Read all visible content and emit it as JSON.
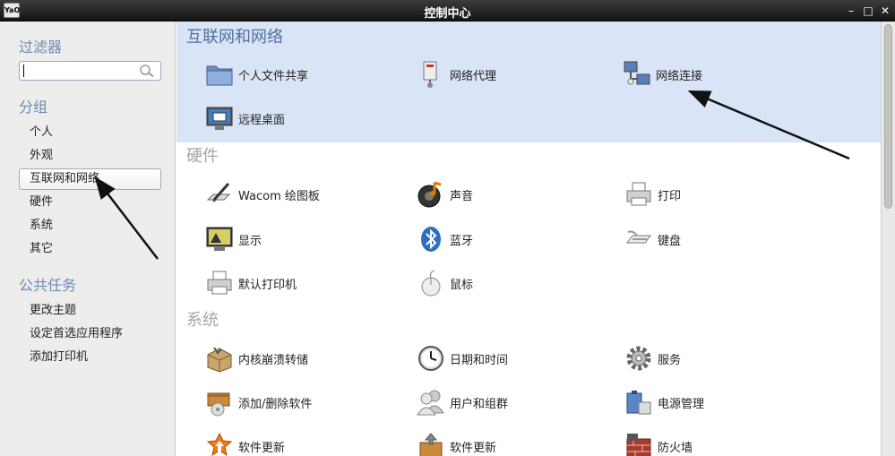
{
  "window": {
    "title": "控制中心",
    "app_icon_text": "YaO"
  },
  "sidebar": {
    "filter_heading": "过滤器",
    "search": {
      "value": "",
      "placeholder": ""
    },
    "group_heading": "分组",
    "groups": [
      {
        "label": "个人"
      },
      {
        "label": "外观"
      },
      {
        "label": "互联网和网络",
        "selected": true
      },
      {
        "label": "硬件"
      },
      {
        "label": "系统"
      },
      {
        "label": "其它"
      }
    ],
    "tasks_heading": "公共任务",
    "tasks": [
      {
        "label": "更改主题"
      },
      {
        "label": "设定首选应用程序"
      },
      {
        "label": "添加打印机"
      }
    ]
  },
  "content": {
    "categories": [
      {
        "heading": "互联网和网络",
        "items": [
          "个人文件共享",
          "网络代理",
          "网络连接",
          "远程桌面"
        ]
      },
      {
        "heading": "硬件",
        "items": [
          "Wacom 绘图板",
          "声音",
          "打印",
          "显示",
          "蓝牙",
          "键盘",
          "默认打印机",
          "鼠标"
        ]
      },
      {
        "heading": "系统",
        "items": [
          "内核崩溃转储",
          "日期和时间",
          "服务",
          "添加/删除软件",
          "用户和组群",
          "电源管理",
          "软件更新",
          "软件更新",
          "防火墙"
        ]
      }
    ]
  },
  "colors": {
    "accent": "#6e89b5",
    "selected_band": "#d9e4f6",
    "titlebar": "#1e1e1e",
    "annotation_arrow": "#111111"
  }
}
